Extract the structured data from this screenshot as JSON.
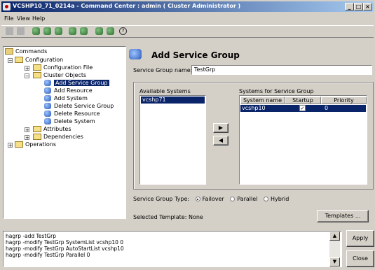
{
  "window": {
    "title": "VCSHP10_71_0214a - Command Center : admin ( Cluster Administrator )"
  },
  "titlebar_buttons": [
    "_",
    "□",
    "×"
  ],
  "menu": [
    "File",
    "View",
    "Help"
  ],
  "tree": {
    "root": "Commands",
    "configuration": "Configuration",
    "config_file": "Configuration File",
    "cluster_objects": "Cluster Objects",
    "items": [
      "Add Service Group",
      "Add Resource",
      "Add System",
      "Delete Service Group",
      "Delete Resource",
      "Delete System"
    ],
    "attributes": "Attributes",
    "dependencies": "Dependencies",
    "operations": "Operations"
  },
  "panel": {
    "title": "Add Service Group",
    "sg_name_label": "Service Group name:",
    "sg_name_value": "TestGrp",
    "available_label": "Available Systems",
    "available_systems": [
      "vcshp71"
    ],
    "systems_label": "Systems for Service Group",
    "columns": [
      "System name",
      "Startup",
      "Priority"
    ],
    "rows": [
      {
        "system": "vcshp10",
        "startup": "✓",
        "priority": "0"
      }
    ],
    "move_right": "▶",
    "move_left": "◀",
    "type_label": "Service Group Type:",
    "types": [
      "Failover",
      "Parallel",
      "Hybrid"
    ],
    "selected_type": "Failover",
    "template_label": "Selected Template: None",
    "templates_button": "Templates ..."
  },
  "commands": [
    "hagrp -add TestGrp",
    "hagrp -modify TestGrp SystemList  vcshp10 0",
    "hagrp -modify TestGrp AutoStartList vcshp10",
    "hagrp -modify TestGrp Parallel 0"
  ],
  "buttons": {
    "apply": "Apply",
    "close": "Close"
  }
}
